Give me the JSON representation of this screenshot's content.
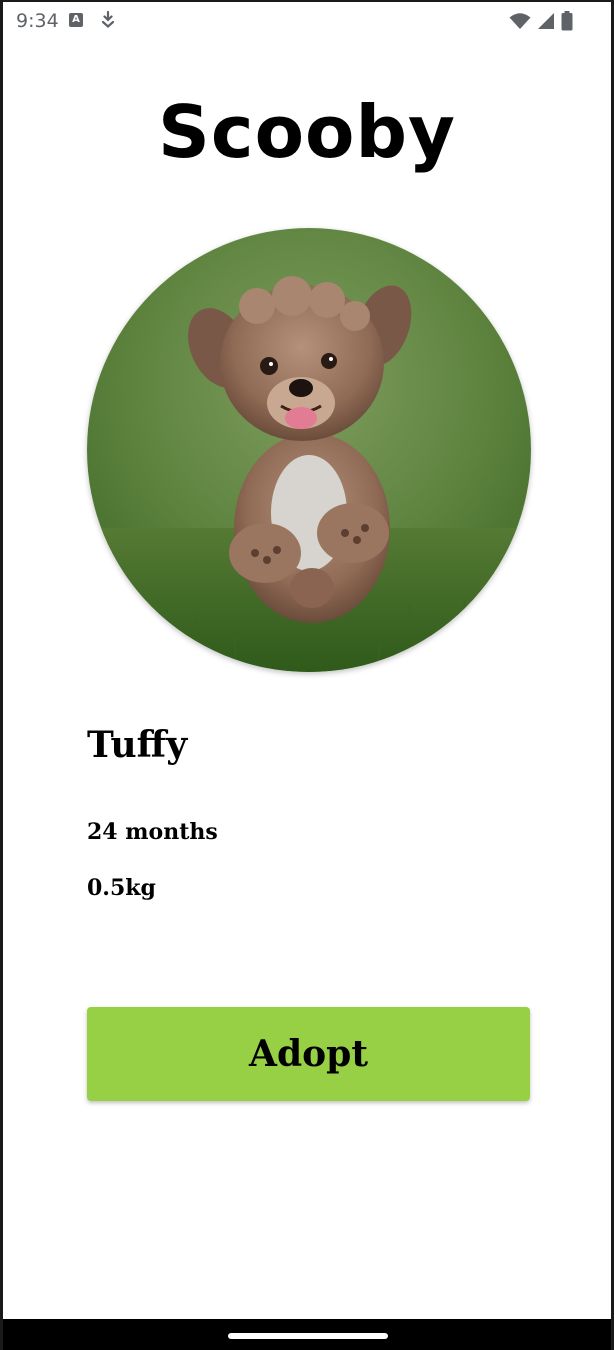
{
  "status_bar": {
    "time": "9:34",
    "notification_icons": [
      "a-icon",
      "download-icon"
    ],
    "system_icons": [
      "wifi-icon",
      "signal-icon",
      "battery-icon"
    ],
    "notif_a_glyph": "A"
  },
  "header": {
    "title": "Scooby"
  },
  "pet": {
    "photo": "dog-photo",
    "name": "Tuffy",
    "age": "24 months",
    "weight": "0.5kg"
  },
  "actions": {
    "adopt_label": "Adopt"
  },
  "colors": {
    "adopt_button": "#97d045",
    "status_icons": "#5f6368",
    "nav_bar": "#000000"
  }
}
